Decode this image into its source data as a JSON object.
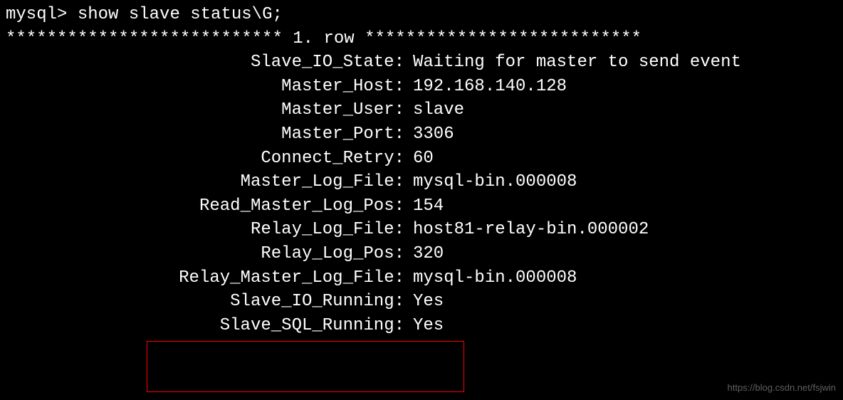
{
  "prompt": "mysql> ",
  "command": "show slave status\\G;",
  "row_header_left": "*************************** ",
  "row_header_text": "1. row",
  "row_header_right": " ***************************",
  "fields": [
    {
      "label": "Slave_IO_State:",
      "value": "Waiting for master to send event"
    },
    {
      "label": "Master_Host:",
      "value": "192.168.140.128"
    },
    {
      "label": "Master_User:",
      "value": "slave"
    },
    {
      "label": "Master_Port:",
      "value": "3306"
    },
    {
      "label": "Connect_Retry:",
      "value": "60"
    },
    {
      "label": "Master_Log_File:",
      "value": "mysql-bin.000008"
    },
    {
      "label": "Read_Master_Log_Pos:",
      "value": "154"
    },
    {
      "label": "Relay_Log_File:",
      "value": "host81-relay-bin.000002"
    },
    {
      "label": "Relay_Log_Pos:",
      "value": "320"
    },
    {
      "label": "Relay_Master_Log_File:",
      "value": "mysql-bin.000008"
    },
    {
      "label": "Slave_IO_Running:",
      "value": "Yes"
    },
    {
      "label": "Slave_SQL_Running:",
      "value": "Yes"
    }
  ],
  "watermark": "https://blog.csdn.net/fsjwin"
}
